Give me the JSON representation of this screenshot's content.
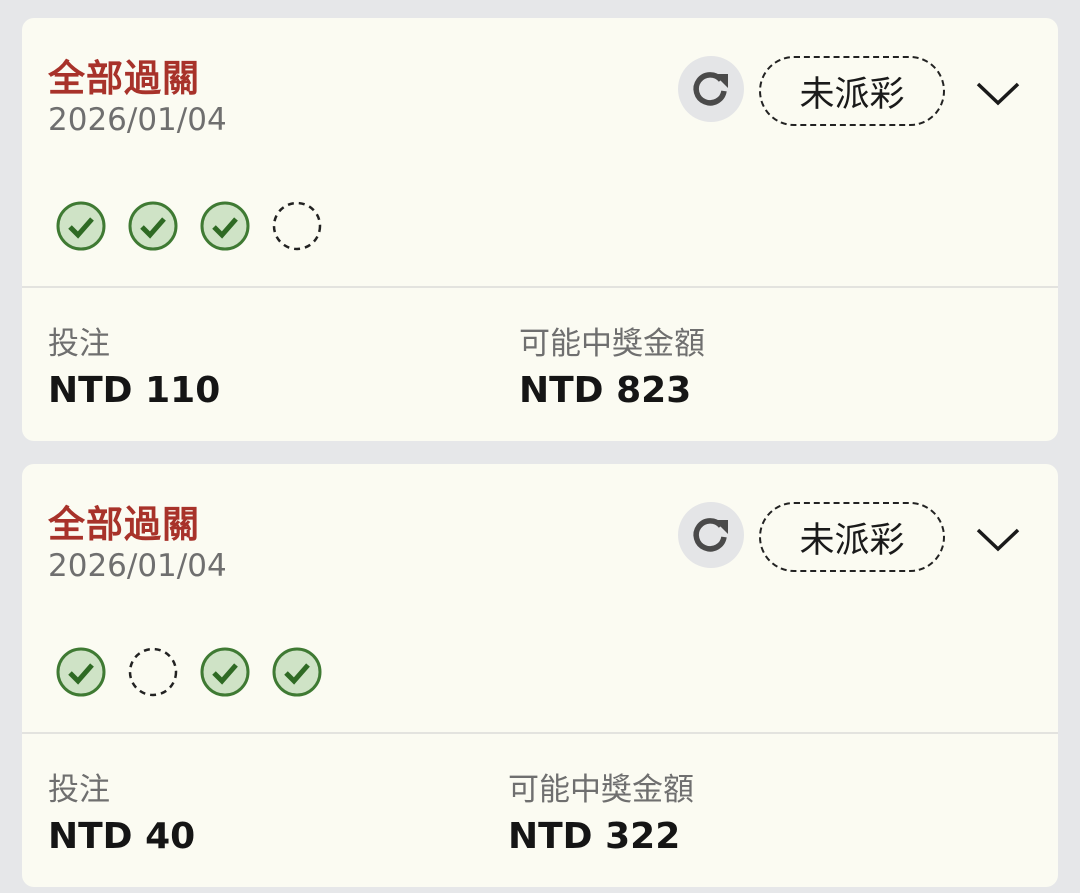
{
  "bets": [
    {
      "title": "全部過關",
      "date": "2026/01/04",
      "status": "未派彩",
      "legs": [
        "won",
        "won",
        "won",
        "pending"
      ],
      "stake_label": "投注",
      "stake_value": "NTD 110",
      "payout_label": "可能中獎金額",
      "payout_value": "NTD 823"
    },
    {
      "title": "全部過關",
      "date": "2026/01/04",
      "status": "未派彩",
      "legs": [
        "won",
        "pending",
        "won",
        "won"
      ],
      "stake_label": "投注",
      "stake_value": "NTD 40",
      "payout_label": "可能中獎金額",
      "payout_value": "NTD 322"
    }
  ],
  "icons": {
    "refresh": "refresh-icon",
    "expand": "chevron-down-icon",
    "leg_won": "check-circle-icon",
    "leg_pending": "dashed-circle-icon"
  },
  "colors": {
    "title": "#a8322a",
    "check_fill": "#cfe3c6",
    "check_stroke": "#3f7a33",
    "card_bg": "#fbfbf2",
    "page_bg": "#e6e7e9"
  }
}
